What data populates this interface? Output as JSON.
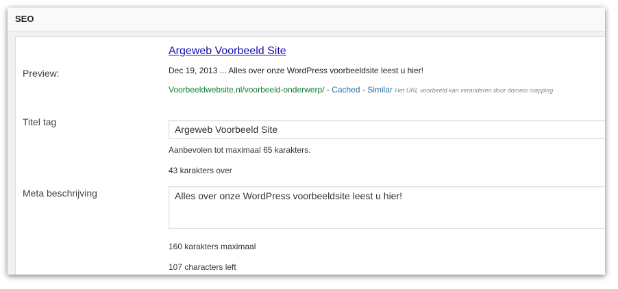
{
  "box": {
    "title": "SEO"
  },
  "preview": {
    "label": "Preview:",
    "title": "Argeweb Voorbeeld Site",
    "description": "Dec 19, 2013 ... Alles over onze WordPress voorbeeldsite leest u hier!",
    "url": "Voorbeeldwebsite.nl/voorbeeld-onderwerp/",
    "separator_1": " - ",
    "cached_label": "Cached",
    "separator_2": " - ",
    "similar_label": "Similar",
    "url_note": "Het URL voorbeeld kan veranderen door domein mapping"
  },
  "title_tag": {
    "label": "Titel tag",
    "value": "Argeweb Voorbeeld Site",
    "hint_max": "Aanbevolen tot maximaal 65 karakters.",
    "hint_remaining": "43 karakters over"
  },
  "meta_description": {
    "label": "Meta beschrijving",
    "value": "Alles over onze WordPress voorbeeldsite leest u hier!",
    "hint_max": "160 karakters maximaal",
    "hint_remaining": "107 characters left"
  },
  "colors": {
    "link": "#1a0dab",
    "url": "#0a7b2b",
    "secondary_link": "#2a6fa0"
  }
}
